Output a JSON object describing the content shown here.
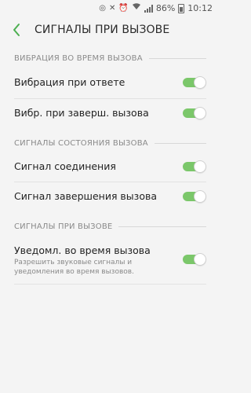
{
  "status_bar": {
    "battery_text": "86%",
    "time": "10:12",
    "icons": [
      "whatsapp-icon",
      "mute-icon",
      "alarm-icon",
      "wifi-icon",
      "signal-icon",
      "battery-icon"
    ]
  },
  "header": {
    "title": "СИГНАЛЫ ПРИ ВЫЗОВЕ",
    "back_icon": "chevron-left-icon"
  },
  "sections": [
    {
      "title": "ВИБРАЦИЯ ВО ВРЕМЯ ВЫЗОВА",
      "items": [
        {
          "label": "Вибрация при ответе",
          "enabled": true
        },
        {
          "label": "Вибр. при заверш. вызова",
          "enabled": true
        }
      ]
    },
    {
      "title": "СИГНАЛЫ СОСТОЯНИЯ ВЫЗОВА",
      "items": [
        {
          "label": "Сигнал соединения",
          "enabled": true
        },
        {
          "label": "Сигнал завершения вызова",
          "enabled": true
        }
      ]
    },
    {
      "title": "СИГНАЛЫ ПРИ ВЫЗОВЕ",
      "items": [
        {
          "label": "Уведомл. во время вызова",
          "description": "Разрешить звуковые сигналы и уведомления во время вызовов.",
          "enabled": true
        }
      ]
    }
  ],
  "colors": {
    "accent": "#4caf50",
    "switch_on": "#7bc76a",
    "background": "#f4f4f4"
  }
}
